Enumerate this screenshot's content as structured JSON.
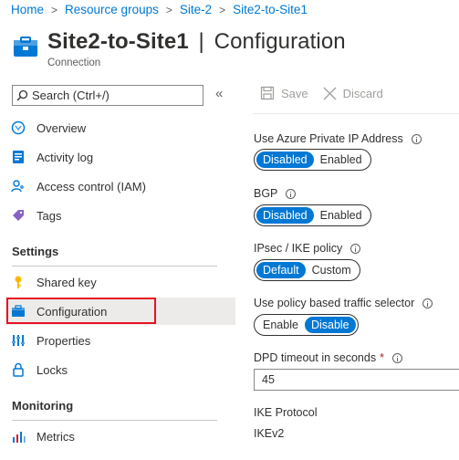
{
  "breadcrumb": [
    {
      "label": "Home"
    },
    {
      "label": "Resource groups"
    },
    {
      "label": "Site-2"
    },
    {
      "label": "Site2-to-Site1"
    }
  ],
  "header": {
    "resource_name": "Site2-to-Site1",
    "separator": "|",
    "blade_title": "Configuration",
    "subtitle": "Connection"
  },
  "search": {
    "placeholder": "Search (Ctrl+/)",
    "collapse_glyph": "«"
  },
  "nav": {
    "items": [
      {
        "label": "Overview",
        "icon": "overview-icon"
      },
      {
        "label": "Activity log",
        "icon": "activity-log-icon"
      },
      {
        "label": "Access control (IAM)",
        "icon": "access-control-icon"
      },
      {
        "label": "Tags",
        "icon": "tag-icon"
      }
    ],
    "settings_label": "Settings",
    "settings_items": [
      {
        "label": "Shared key",
        "icon": "key-icon"
      },
      {
        "label": "Configuration",
        "icon": "configuration-icon",
        "selected": true
      },
      {
        "label": "Properties",
        "icon": "properties-icon"
      },
      {
        "label": "Locks",
        "icon": "lock-icon"
      }
    ],
    "monitoring_label": "Monitoring",
    "monitoring_items": [
      {
        "label": "Metrics",
        "icon": "metrics-icon"
      }
    ]
  },
  "toolbar": {
    "save_label": "Save",
    "discard_label": "Discard"
  },
  "form": {
    "private_ip": {
      "label": "Use Azure Private IP Address",
      "options": [
        "Disabled",
        "Enabled"
      ],
      "selected": "Disabled"
    },
    "bgp": {
      "label": "BGP",
      "options": [
        "Disabled",
        "Enabled"
      ],
      "selected": "Disabled"
    },
    "ipsec": {
      "label": "IPsec / IKE policy",
      "options": [
        "Default",
        "Custom"
      ],
      "selected": "Default"
    },
    "policy_selector": {
      "label": "Use policy based traffic selector",
      "options": [
        "Enable",
        "Disable"
      ],
      "selected": "Disable"
    },
    "dpd": {
      "label": "DPD timeout in seconds",
      "required_mark": "*",
      "value": "45"
    },
    "ike": {
      "label": "IKE Protocol",
      "value": "IKEv2"
    }
  },
  "colors": {
    "accent": "#0078d4",
    "highlight_border": "#e81123",
    "selected_bg": "#edebe9"
  }
}
